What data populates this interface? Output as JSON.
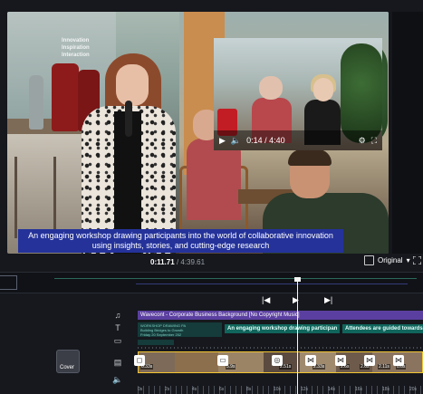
{
  "preview": {
    "background_sign": [
      "Innovation",
      "Inspiration",
      "Interaction"
    ],
    "pip_time": "0:14 / 4:40",
    "caption_lines": [
      "An engaging workshop drawing participants into the world of collaborative innovation",
      "using insights, stories, and cutting-edge research"
    ]
  },
  "player": {
    "current_time": "0:11.71",
    "total_time": "/ 4:39.61",
    "aspect_label": "Original"
  },
  "timeline": {
    "music_clip": "Wavecont - Corporate Business Background [No Copyright Music]",
    "caption_small": [
      "WORKSHOP DRAWING PA",
      "Building Bridges to Growth",
      "Friday 20 September 202"
    ],
    "caption_clip_2": "An engaging workshop drawing participan",
    "caption_clip_3": "Attendees are guided towards",
    "cover_label": "Cover",
    "clip_durations": [
      "6.33s",
      "5.9s",
      "2.51s",
      "2.33s",
      "2.6s",
      "2.6s",
      "2.11s",
      "0.6s"
    ],
    "ruler_labels": [
      "0s",
      "2s",
      "4s",
      "6s",
      "8s",
      "10s",
      "12s",
      "14s",
      "16s",
      "18s",
      "20s"
    ]
  },
  "colors": {
    "caption_bg": "#24329a",
    "music_track": "#5b3fa0",
    "caption_track": "#10655c",
    "selection": "#f3c533"
  }
}
